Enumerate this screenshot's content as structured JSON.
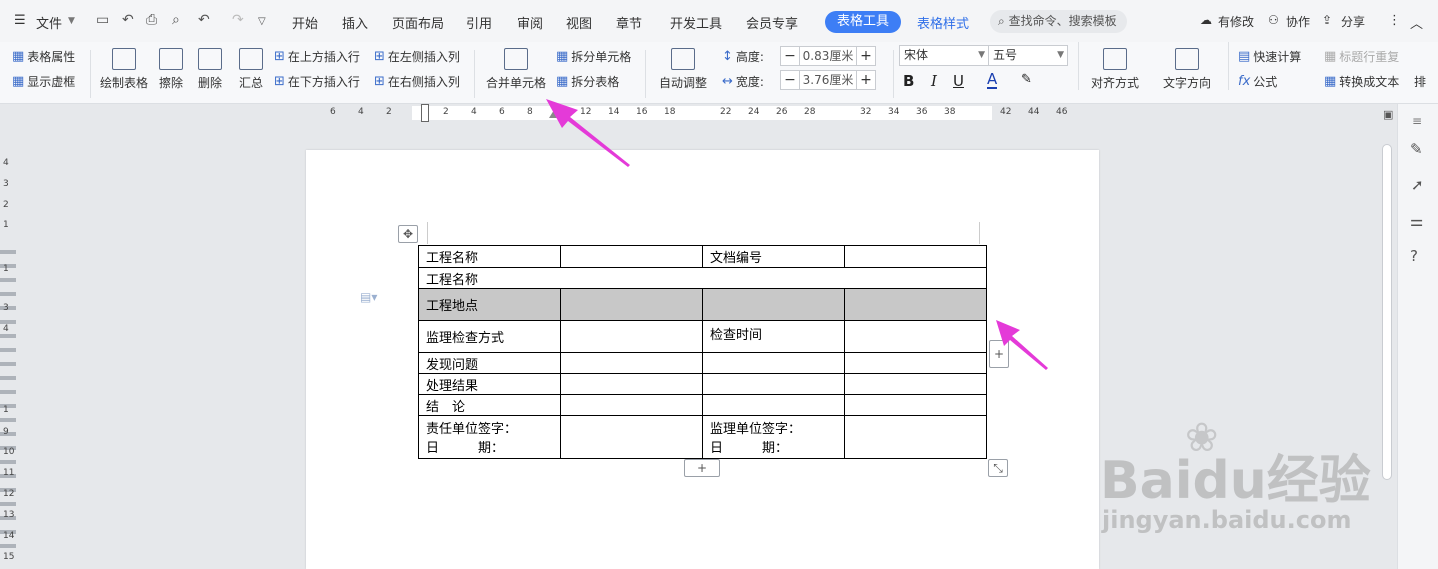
{
  "menubar": {
    "file": "文件",
    "tabs": [
      "开始",
      "插入",
      "页面布局",
      "引用",
      "审阅",
      "视图",
      "章节",
      "开发工具",
      "会员专享"
    ],
    "active_tab": "表格工具",
    "style_tab": "表格样式",
    "search_placeholder": "查找命令、搜索模板",
    "modified": "有修改",
    "collab": "协作",
    "share": "分享"
  },
  "ribbon": {
    "table_props": "表格属性",
    "show_gridlines": "显示虚框",
    "draw_table": "绘制表格",
    "erase": "擦除",
    "delete": "删除",
    "summary": "汇总",
    "insert_above": "在上方插入行",
    "insert_below": "在下方插入行",
    "insert_left": "在左侧插入列",
    "insert_right": "在右侧插入列",
    "merge_cells": "合并单元格",
    "split_cells": "拆分单元格",
    "split_table": "拆分表格",
    "auto_adjust": "自动调整",
    "height_label": "高度:",
    "height_value": "0.83厘米",
    "width_label": "宽度:",
    "width_value": "3.76厘米",
    "font_name": "宋体",
    "font_size": "五号",
    "align": "对齐方式",
    "text_dir": "文字方向",
    "quick_calc": "快速计算",
    "header_repeat": "标题行重复",
    "formula": "公式",
    "to_text": "转换成文本",
    "more": "排"
  },
  "ruler": {
    "h_marks": [
      "6",
      "4",
      "2",
      "2",
      "4",
      "6",
      "8",
      "12",
      "14",
      "16",
      "18",
      "22",
      "24",
      "26",
      "28",
      "32",
      "34",
      "36",
      "38",
      "42",
      "44",
      "46"
    ],
    "v_marks": [
      "4",
      "3",
      "2",
      "1",
      "1",
      "3",
      "4",
      "1",
      "9",
      "10",
      "11",
      "12",
      "13",
      "14",
      "15"
    ]
  },
  "table": {
    "rows": [
      [
        "工程名称",
        "",
        "文档编号",
        ""
      ],
      [
        "工程名称"
      ],
      [
        "工程地点",
        "",
        "",
        ""
      ],
      [
        "监理检查方式",
        "",
        "检查时间",
        ""
      ],
      [
        "发现问题",
        "",
        "",
        ""
      ],
      [
        "处理结果",
        "",
        "",
        ""
      ],
      [
        "结　论",
        "",
        "",
        ""
      ],
      [
        "责任单位签字：",
        "",
        "监理单位签字：",
        ""
      ]
    ],
    "date_label": "日　　　期："
  },
  "watermark": {
    "brand": "Baidu经验",
    "url": "jingyan.baidu.com"
  },
  "colors": {
    "accent": "#3d7ef5",
    "arrow": "#e43ad8",
    "shade": "#c8c8c8"
  }
}
